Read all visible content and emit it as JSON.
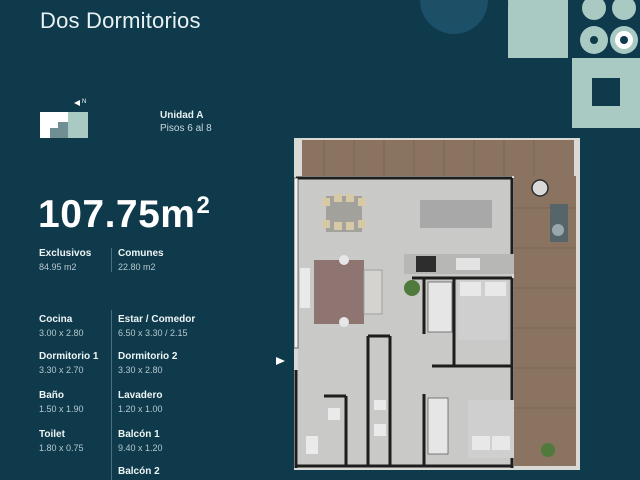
{
  "header": {
    "title": "Dos Dormitorios"
  },
  "unit": {
    "name": "Unidad A",
    "floors": "Pisos 6 al 8"
  },
  "compass": {
    "label": "N"
  },
  "area": {
    "value": "107.75m",
    "unit_sup": "2"
  },
  "areas": [
    {
      "label": "Exclusivos",
      "value": "84.95 m2"
    },
    {
      "label": "Comunes",
      "value": "22.80 m2"
    }
  ],
  "rooms": [
    {
      "label": "Cocina",
      "value": "3.00 x 2.80"
    },
    {
      "label": "Estar / Comedor",
      "value": "6.50 x 3.30 / 2.15"
    },
    {
      "label": "Dormitorio 1",
      "value": "3.30 x 2.70"
    },
    {
      "label": "Dormitorio 2",
      "value": "3.30 x 2.80"
    },
    {
      "label": "Baño",
      "value": "1.50 x 1.90"
    },
    {
      "label": "Lavadero",
      "value": "1.20 x 1.00"
    },
    {
      "label": "Toilet",
      "value": "1.80 x 0.75"
    },
    {
      "label": "Balcón 1",
      "value": "9.40 x 1.20"
    },
    {
      "label": "Balcón 2",
      "value": ""
    }
  ],
  "colors": {
    "background": "#0f3a4c",
    "accent_mint": "#a9c9c3",
    "accent_dark": "#0f3a4c",
    "accent_navy": "#123b53"
  }
}
